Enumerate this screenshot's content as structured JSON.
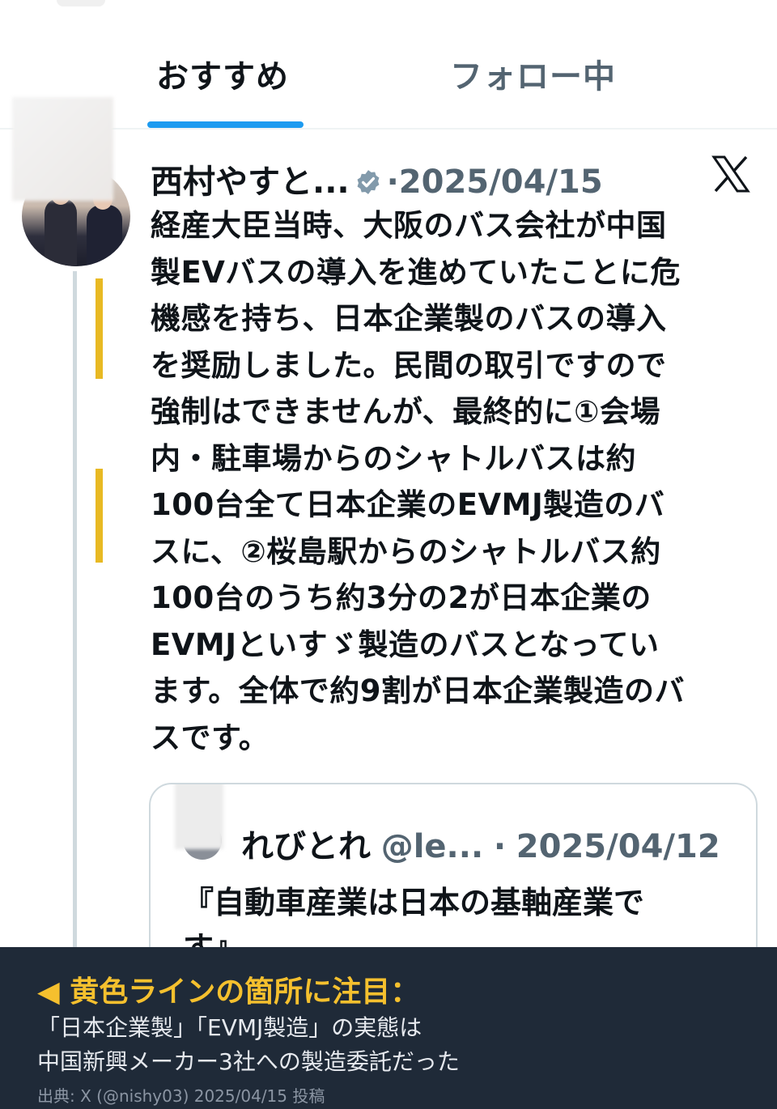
{
  "tabs": {
    "recommended": "おすすめ",
    "following": "フォロー中"
  },
  "tweet": {
    "author_name": "西村やすと...",
    "separator": "·",
    "date": "2025/04/15",
    "body": "経産大臣当時、大阪のバス会社が中国\n製EVバスの導入を進めていたことに危\n機感を持ち、日本企業製のバスの導入\nを奨励しました。民間の取引ですので\n強制はできませんが、最終的に①会場\n内・駐車場からのシャトルバスは約\n100台全て日本企業のEVMJ製造のバ\nスに、②桜島駅からのシャトルバス約\n100台のうち約3分の2が日本企業の\nEVMJといすゞ製造のバスとなってい\nます。全体で約9割が日本企業製造のバ\nスです。"
  },
  "quote": {
    "author_name": "れびとれ",
    "handle": "@le...",
    "separator": "·",
    "date": "2025/04/12",
    "text": "『自動車産業は日本の基軸産業で\nす』"
  },
  "banner": {
    "title": "◀ 黄色ラインの箇所に注目：",
    "line1": "「日本企業製」「EVMJ製造」の実態は",
    "line2": "中国新興メーカー3社への製造委託だった",
    "source": "出典: X (@nishy03) 2025/04/15 投稿"
  },
  "colors": {
    "accent": "#1d9bf0",
    "highlight": "#e8b923",
    "banner_bg": "#1f2a38",
    "banner_title": "#f5c02e"
  },
  "icons": {
    "verified": "verified-badge-icon",
    "x_logo": "x-logo-icon"
  }
}
